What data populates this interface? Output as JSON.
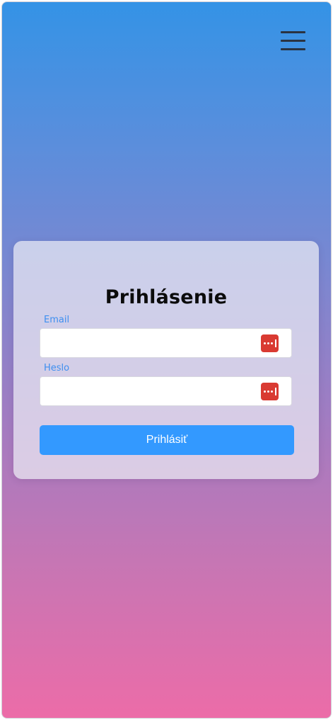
{
  "header": {
    "menu_icon": "hamburger-menu-icon"
  },
  "login": {
    "title": "Prihlásenie",
    "email": {
      "label": "Email",
      "value": "",
      "placeholder": "",
      "icon": "password-manager-icon"
    },
    "password": {
      "label": "Heslo",
      "value": "",
      "placeholder": "",
      "icon": "password-manager-icon"
    },
    "submit_label": "Prihlásiť"
  },
  "colors": {
    "gradient_top": "#3493e6",
    "gradient_bottom": "#ec6ca8",
    "accent": "#3399ff",
    "label": "#3e8ff0",
    "password_icon": "#d93a32"
  }
}
